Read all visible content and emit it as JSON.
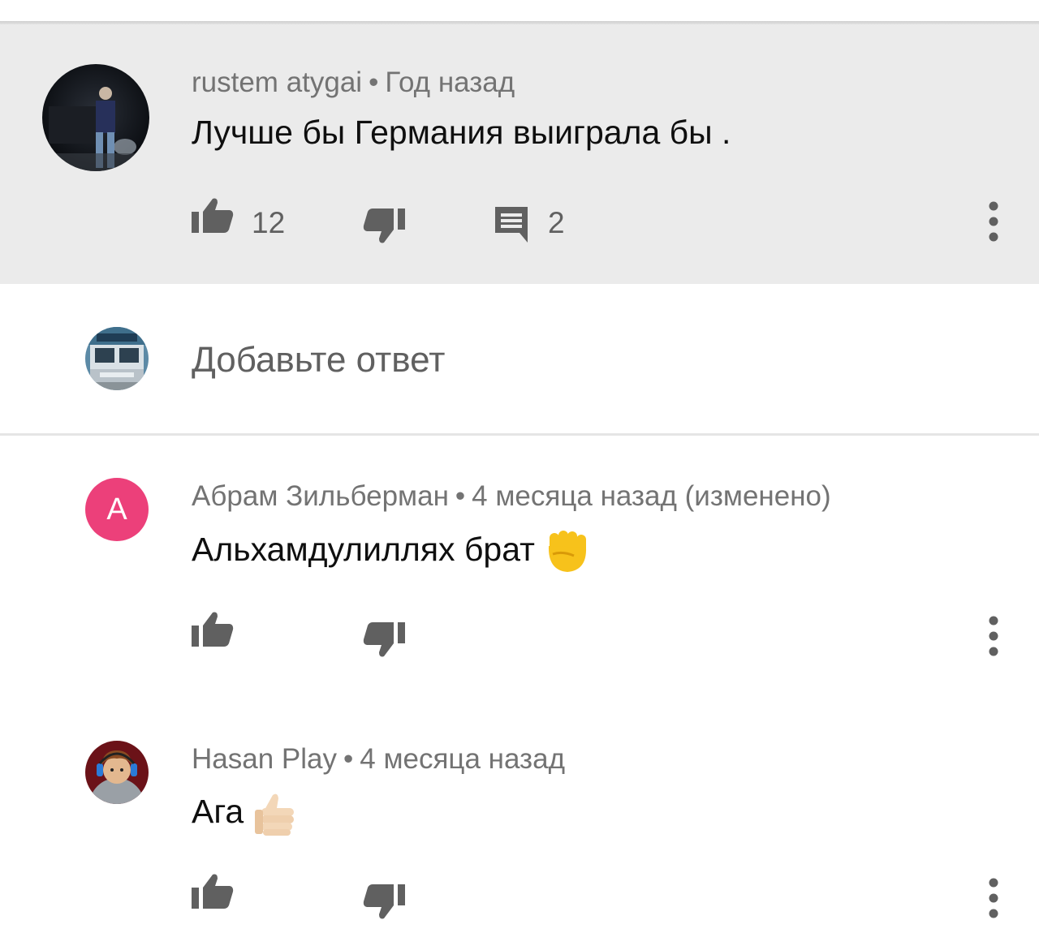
{
  "parent_comment": {
    "author": "rustem atygai",
    "separator": "•",
    "time": "Год назад",
    "text": "Лучше бы Германия выиграла бы .",
    "like_count": "12",
    "reply_count": "2",
    "icons": [
      "like-icon",
      "dislike-icon",
      "reply-icon",
      "more-options-icon"
    ]
  },
  "reply_box": {
    "placeholder": "Добавьте ответ"
  },
  "replies": [
    {
      "author": "Абрам Зильберман",
      "separator": "•",
      "time": "4 месяца назад (изменено)",
      "text": "Альхамдулиллях брат",
      "emoji": "raised-fist-emoji",
      "avatar_letter": "А",
      "avatar_color": "#ec407a"
    },
    {
      "author": "Hasan Play",
      "separator": "•",
      "time": "4 месяца назад",
      "text": "Ага",
      "emoji": "thumbs-up-emoji"
    }
  ],
  "colors": {
    "parent_background": "#ebebeb",
    "meta_text": "#737373",
    "body_text": "#0f0f0f",
    "icon": "#606060"
  }
}
